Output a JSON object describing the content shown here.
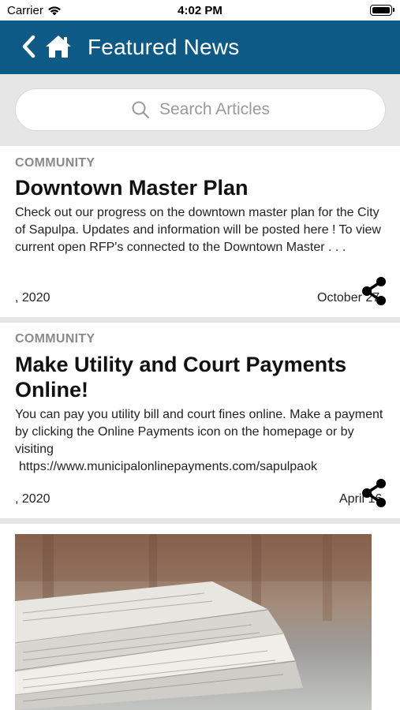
{
  "status_bar": {
    "carrier": "Carrier",
    "time": "4:02 PM"
  },
  "header": {
    "title": "Featured News"
  },
  "search": {
    "placeholder": "Search Articles"
  },
  "articles": [
    {
      "category": "COMMUNITY",
      "title": "Downtown Master Plan",
      "excerpt": "Check out our progress on the downtown master plan for the City of Sapulpa. Updates and information will be posted here ! To view current open RFP's connected to the Downtown Master . . .",
      "date_left": ", 2020",
      "date_right": "October 27"
    },
    {
      "category": "COMMUNITY",
      "title": "Make Utility and Court Payments Online!",
      "excerpt": "You can pay you utility bill and court fines online. Make a payment by clicking the Online Payments icon on the homepage or by visiting",
      "link": "https://www.municipalonlinepayments.com/sapulpaok",
      "date_left": ", 2020",
      "date_right": "April 16"
    }
  ],
  "colors": {
    "header_bg": "#0e5a87",
    "page_bg": "#e6e6e6"
  }
}
